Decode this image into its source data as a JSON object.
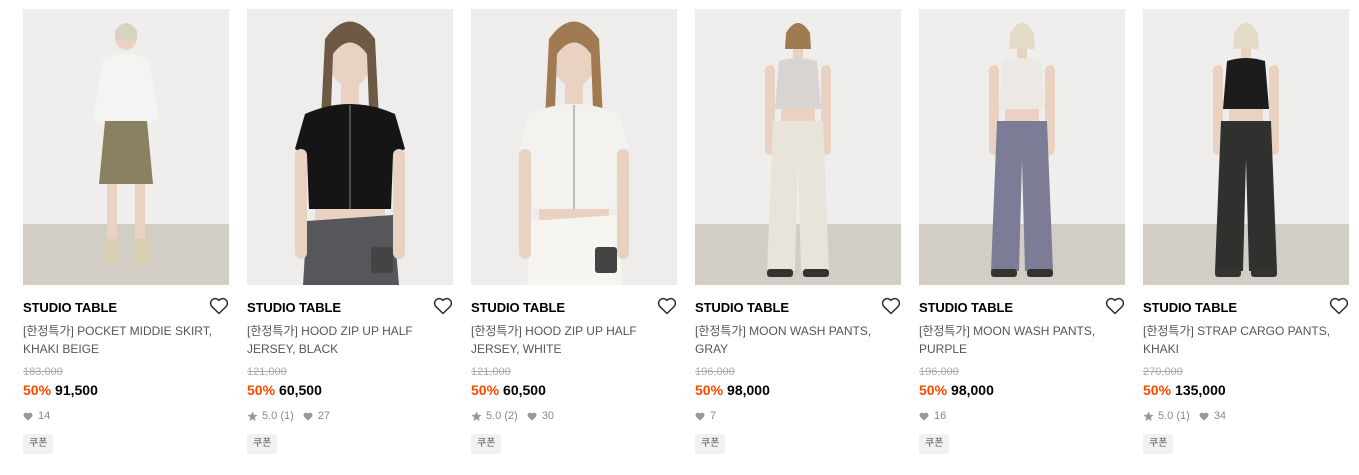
{
  "products": [
    {
      "brand": "STUDIO TABLE",
      "name": "[한정특가] POCKET MIDDIE SKIRT, KHAKI BEIGE",
      "original_price": "183,000",
      "discount": "50%",
      "price": "91,500",
      "rating": "",
      "reviews": "",
      "likes": "14",
      "coupon": "쿠폰",
      "top_color": "#f4f4f2",
      "bottom_color": "#8a8062",
      "hair_color": "#d8d2c2",
      "style": "skirt"
    },
    {
      "brand": "STUDIO TABLE",
      "name": "[한정특가] HOOD ZIP UP HALF JERSEY, BLACK",
      "original_price": "121,000",
      "discount": "50%",
      "price": "60,500",
      "rating": "5.0",
      "reviews": "(1)",
      "likes": "27",
      "coupon": "쿠폰",
      "top_color": "#151515",
      "bottom_color": "#55575a",
      "hair_color": "#6e5a44",
      "style": "closeup"
    },
    {
      "brand": "STUDIO TABLE",
      "name": "[한정특가] HOOD ZIP UP HALF JERSEY, WHITE",
      "original_price": "121,000",
      "discount": "50%",
      "price": "60,500",
      "rating": "5.0",
      "reviews": "(2)",
      "likes": "30",
      "coupon": "쿠폰",
      "top_color": "#f3f2ee",
      "bottom_color": "#f6f5f2",
      "hair_color": "#a07a52",
      "style": "closeup"
    },
    {
      "brand": "STUDIO TABLE",
      "name": "[한정특가] MOON WASH PANTS, GRAY",
      "original_price": "196,000",
      "discount": "50%",
      "price": "98,000",
      "rating": "",
      "reviews": "",
      "likes": "7",
      "coupon": "쿠폰",
      "top_color": "#d9d4d2",
      "bottom_color": "#e8e4dc",
      "hair_color": "#a07a52",
      "style": "pants"
    },
    {
      "brand": "STUDIO TABLE",
      "name": "[한정특가] MOON WASH PANTS, PURPLE",
      "original_price": "196,000",
      "discount": "50%",
      "price": "98,000",
      "rating": "",
      "reviews": "",
      "likes": "16",
      "coupon": "쿠폰",
      "top_color": "#ece9e4",
      "bottom_color": "#7c7c96",
      "hair_color": "#e2dcc9",
      "style": "pants"
    },
    {
      "brand": "STUDIO TABLE",
      "name": "[한정특가] STRAP CARGO PANTS, KHAKI",
      "original_price": "270,000",
      "discount": "50%",
      "price": "135,000",
      "rating": "5.0",
      "reviews": "(1)",
      "likes": "34",
      "coupon": "쿠폰",
      "top_color": "#1c1c1c",
      "bottom_color": "#2e312d",
      "hair_color": "#e2dcc9",
      "style": "pants"
    }
  ]
}
